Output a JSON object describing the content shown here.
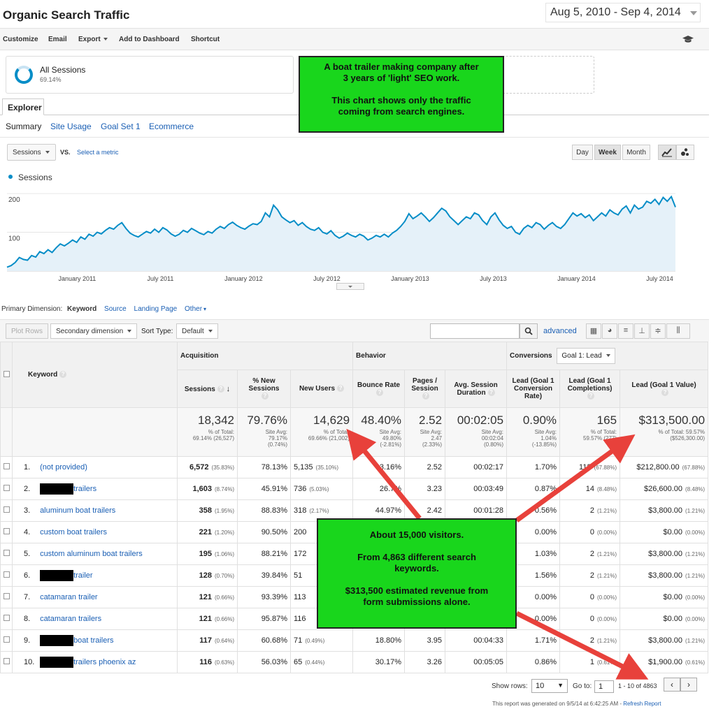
{
  "header": {
    "title": "Organic Search Traffic",
    "date_range": "Aug 5, 2010 - Sep 4, 2014"
  },
  "toolbar": {
    "customize": "Customize",
    "email": "Email",
    "export": "Export",
    "add_to_dashboard": "Add to Dashboard",
    "shortcut": "Shortcut"
  },
  "segment": {
    "label": "All Sessions",
    "percent": "69.14%"
  },
  "explorer": {
    "tab": "Explorer",
    "subtabs": [
      "Summary",
      "Site Usage",
      "Goal Set 1",
      "Ecommerce"
    ]
  },
  "chart_controls": {
    "metric": "Sessions",
    "vs": "VS.",
    "select_metric": "Select a metric",
    "day": "Day",
    "week": "Week",
    "month": "Month"
  },
  "chart_data": {
    "type": "area",
    "series": [
      {
        "name": "Sessions",
        "values": [
          10,
          14,
          22,
          35,
          30,
          28,
          40,
          36,
          50,
          45,
          55,
          48,
          60,
          70,
          65,
          72,
          80,
          74,
          88,
          82,
          95,
          90,
          100,
          96,
          105,
          112,
          108,
          118,
          125,
          110,
          98,
          92,
          88,
          95,
          102,
          98,
          108,
          100,
          112,
          106,
          96,
          90,
          95,
          105,
          100,
          110,
          104,
          98,
          94,
          102,
          98,
          108,
          115,
          110,
          120,
          126,
          118,
          112,
          108,
          116,
          122,
          120,
          128,
          150,
          140,
          170,
          158,
          140,
          132,
          125,
          130,
          118,
          125,
          115,
          108,
          105,
          112,
          100,
          96,
          104,
          92,
          85,
          90,
          98,
          92,
          88,
          95,
          90,
          80,
          85,
          92,
          88,
          95,
          88,
          98,
          105,
          115,
          128,
          148,
          135,
          142,
          150,
          140,
          128,
          138,
          150,
          162,
          155,
          140,
          130,
          120,
          130,
          140,
          135,
          150,
          145,
          130,
          120,
          140,
          150,
          132,
          118,
          110,
          115,
          100,
          95,
          110,
          118,
          112,
          125,
          120,
          108,
          118,
          125,
          115,
          110,
          120,
          135,
          150,
          142,
          148,
          138,
          145,
          130,
          140,
          150,
          142,
          158,
          150,
          145,
          160,
          168,
          150,
          170,
          160,
          165,
          180,
          175,
          185,
          172,
          190,
          180,
          192,
          165
        ]
      }
    ],
    "x_tick_labels": [
      "January 2011",
      "July 2011",
      "January 2012",
      "July 2012",
      "January 2013",
      "July 2013",
      "January 2014",
      "July 2014"
    ],
    "y_tick_labels": [
      "200",
      "100"
    ],
    "ylim": [
      0,
      220
    ],
    "grid": true
  },
  "primary_dimension": {
    "label": "Primary Dimension:",
    "active": "Keyword",
    "options": [
      "Source",
      "Landing Page",
      "Other"
    ]
  },
  "table_controls": {
    "plot_rows": "Plot Rows",
    "secondary_dimension": "Secondary dimension",
    "sort_type_label": "Sort Type:",
    "sort_type": "Default",
    "advanced": "advanced"
  },
  "table": {
    "group_headers": {
      "acquisition": "Acquisition",
      "behavior": "Behavior",
      "conversions": "Conversions",
      "goal_select": "Goal 1: Lead"
    },
    "columns": {
      "keyword": "Keyword",
      "sessions": "Sessions",
      "pct_new_sessions": "% New Sessions",
      "new_users": "New Users",
      "bounce_rate": "Bounce Rate",
      "pages_session": "Pages / Session",
      "avg_duration": "Avg. Session Duration",
      "lead_rate": "Lead (Goal 1 Conversion Rate)",
      "lead_completions": "Lead (Goal 1 Completions)",
      "lead_value": "Lead (Goal 1 Value)"
    },
    "totals": {
      "sessions": "18,342",
      "sessions_sub1": "% of Total:",
      "sessions_sub2": "69.14% (26,527)",
      "pct_new": "79.76%",
      "pct_new_sub1": "Site Avg:",
      "pct_new_sub2": "79.17%",
      "pct_new_sub3": "(0.74%)",
      "new_users": "14,629",
      "new_users_sub1": "% of Total:",
      "new_users_sub2": "69.66% (21,002)",
      "bounce": "48.40%",
      "bounce_sub1": "Site Avg:",
      "bounce_sub2": "49.80%",
      "bounce_sub3": "(-2.81%)",
      "pages": "2.52",
      "pages_sub1": "Site Avg:",
      "pages_sub2": "2.47",
      "pages_sub3": "(2.33%)",
      "duration": "00:02:05",
      "duration_sub1": "Site Avg:",
      "duration_sub2": "00:02:04",
      "duration_sub3": "(0.80%)",
      "rate": "0.90%",
      "rate_sub1": "Site Avg:",
      "rate_sub2": "1.04%",
      "rate_sub3": "(-13.85%)",
      "completions": "165",
      "completions_sub1": "% of Total:",
      "completions_sub2": "59.57% (277)",
      "value": "$313,500.00",
      "value_sub1": "% of Total: 59.57%",
      "value_sub2": "($526,300.00)"
    },
    "rows": [
      {
        "num": "1.",
        "kw": "(not provided)",
        "redacted": false,
        "sessions": "6,572",
        "sessions_pct": "(35.83%)",
        "pct_new": "78.13%",
        "new_users": "5,135",
        "new_users_pct": "(35.10%)",
        "bounce": "3.16%",
        "pages": "2.52",
        "duration": "00:02:17",
        "rate": "1.70%",
        "comp": "112",
        "comp_pct": "(67.88%)",
        "value": "$212,800.00",
        "value_pct": "(67.88%)"
      },
      {
        "num": "2.",
        "kw": "trailers",
        "redacted": true,
        "sessions": "1,603",
        "sessions_pct": "(8.74%)",
        "pct_new": "45.91%",
        "new_users": "736",
        "new_users_pct": "(5.03%)",
        "bounce": "26.7%",
        "pages": "3.23",
        "duration": "00:03:49",
        "rate": "0.87%",
        "comp": "14",
        "comp_pct": "(8.48%)",
        "value": "$26,600.00",
        "value_pct": "(8.48%)"
      },
      {
        "num": "3.",
        "kw": "aluminum boat trailers",
        "redacted": false,
        "sessions": "358",
        "sessions_pct": "(1.95%)",
        "pct_new": "88.83%",
        "new_users": "318",
        "new_users_pct": "(2.17%)",
        "bounce": "44.97%",
        "pages": "2.42",
        "duration": "00:01:28",
        "rate": "0.56%",
        "comp": "2",
        "comp_pct": "(1.21%)",
        "value": "$3,800.00",
        "value_pct": "(1.21%)"
      },
      {
        "num": "4.",
        "kw": "custom boat trailers",
        "redacted": false,
        "sessions": "221",
        "sessions_pct": "(1.20%)",
        "pct_new": "90.50%",
        "new_users": "200",
        "new_users_pct": "",
        "bounce": "",
        "pages": "",
        "duration": "",
        "rate": "0.00%",
        "comp": "0",
        "comp_pct": "(0.00%)",
        "value": "$0.00",
        "value_pct": "(0.00%)"
      },
      {
        "num": "5.",
        "kw": "custom aluminum boat trailers",
        "redacted": false,
        "sessions": "195",
        "sessions_pct": "(1.06%)",
        "pct_new": "88.21%",
        "new_users": "172",
        "new_users_pct": "",
        "bounce": "",
        "pages": "",
        "duration": "",
        "rate": "1.03%",
        "comp": "2",
        "comp_pct": "(1.21%)",
        "value": "$3,800.00",
        "value_pct": "(1.21%)"
      },
      {
        "num": "6.",
        "kw": "trailer",
        "redacted": true,
        "sessions": "128",
        "sessions_pct": "(0.70%)",
        "pct_new": "39.84%",
        "new_users": "51",
        "new_users_pct": "",
        "bounce": "",
        "pages": "",
        "duration": "",
        "rate": "1.56%",
        "comp": "2",
        "comp_pct": "(1.21%)",
        "value": "$3,800.00",
        "value_pct": "(1.21%)"
      },
      {
        "num": "7.",
        "kw": "catamaran trailer",
        "redacted": false,
        "sessions": "121",
        "sessions_pct": "(0.66%)",
        "pct_new": "93.39%",
        "new_users": "113",
        "new_users_pct": "",
        "bounce": "",
        "pages": "",
        "duration": "",
        "rate": "0.00%",
        "comp": "0",
        "comp_pct": "(0.00%)",
        "value": "$0.00",
        "value_pct": "(0.00%)"
      },
      {
        "num": "8.",
        "kw": "catamaran trailers",
        "redacted": false,
        "sessions": "121",
        "sessions_pct": "(0.66%)",
        "pct_new": "95.87%",
        "new_users": "116",
        "new_users_pct": "",
        "bounce": "",
        "pages": "",
        "duration": "",
        "rate": "0.00%",
        "comp": "0",
        "comp_pct": "(0.00%)",
        "value": "$0.00",
        "value_pct": "(0.00%)"
      },
      {
        "num": "9.",
        "kw": "boat trailers",
        "redacted": true,
        "sessions": "117",
        "sessions_pct": "(0.64%)",
        "pct_new": "60.68%",
        "new_users": "71",
        "new_users_pct": "(0.49%)",
        "bounce": "18.80%",
        "pages": "3.95",
        "duration": "00:04:33",
        "rate": "1.71%",
        "comp": "2",
        "comp_pct": "(1.21%)",
        "value": "$3,800.00",
        "value_pct": "(1.21%)"
      },
      {
        "num": "10.",
        "kw": "trailers phoenix az",
        "redacted": true,
        "sessions": "116",
        "sessions_pct": "(0.63%)",
        "pct_new": "56.03%",
        "new_users": "65",
        "new_users_pct": "(0.44%)",
        "bounce": "30.17%",
        "pages": "3.26",
        "duration": "00:05:05",
        "rate": "0.86%",
        "comp": "1",
        "comp_pct": "(0.61%)",
        "value": "$1,900.00",
        "value_pct": "(0.61%)"
      }
    ]
  },
  "pagination": {
    "show_rows_label": "Show rows:",
    "show_rows": "10",
    "goto_label": "Go to:",
    "goto_value": "1",
    "range": "1 - 10 of 4863"
  },
  "footer": {
    "generated": "This report was generated on 9/5/14 at 6:42:25 AM -",
    "refresh": "Refresh Report"
  },
  "annotations": {
    "note1_line1": "A boat trailer making company after",
    "note1_line2": "3 years of 'light' SEO work.",
    "note1_line3": "This chart shows only the traffic",
    "note1_line4": "coming from search engines.",
    "note2_line1": "About 15,000 visitors.",
    "note2_line2": "From 4,863 different search",
    "note2_line3": "keywords.",
    "note2_line4": "$313,500 estimated revenue from",
    "note2_line5": "form submissions alone."
  },
  "colors": {
    "series": "#058dc7",
    "area_fill": "#e5f1f9",
    "annotation_bg": "#19d61c",
    "arrow": "#e8413b",
    "link": "#1a5fb4"
  }
}
